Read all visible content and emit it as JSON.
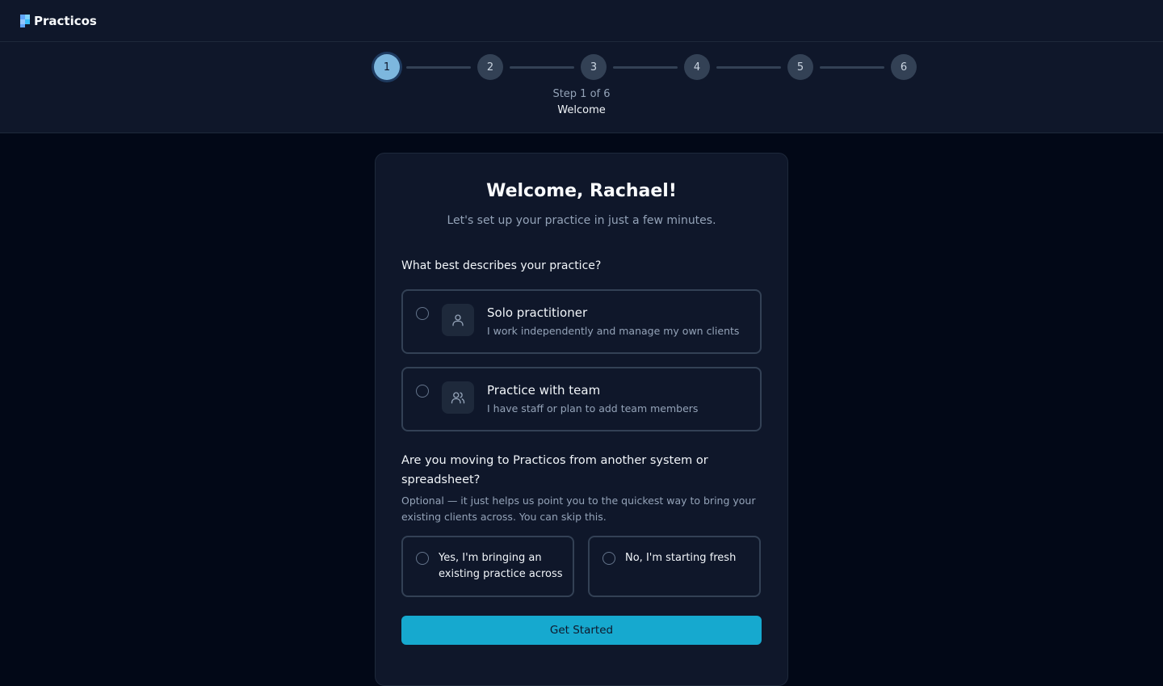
{
  "app": {
    "name": "Practicos"
  },
  "stepper": {
    "steps": [
      "1",
      "2",
      "3",
      "4",
      "5",
      "6"
    ],
    "active_step": 1,
    "caption": "Step 1 of 6",
    "title": "Welcome"
  },
  "card": {
    "title": "Welcome, Rachael!",
    "subtitle": "Let's set up your practice in just a few minutes.",
    "question1": "What best describes your practice?",
    "options": [
      {
        "title": "Solo practitioner",
        "description": "I work independently and manage my own clients",
        "icon": "user-icon",
        "selected": false
      },
      {
        "title": "Practice with team",
        "description": "I have staff or plan to add team members",
        "icon": "users-icon",
        "selected": false
      }
    ],
    "question2": "Are you moving to Practicos from another system or spreadsheet?",
    "question2_help": "Optional — it just helps us point you to the quickest way to bring your existing clients across. You can skip this.",
    "migration_options": [
      {
        "label": "Yes, I'm bringing an existing practice across",
        "selected": false
      },
      {
        "label": "No, I'm starting fresh",
        "selected": false
      }
    ],
    "cta_label": "Get Started"
  },
  "colors": {
    "background": "#020817",
    "surface": "#0f172a",
    "accent": "#16a9cf",
    "active_step": "#7db7de"
  }
}
